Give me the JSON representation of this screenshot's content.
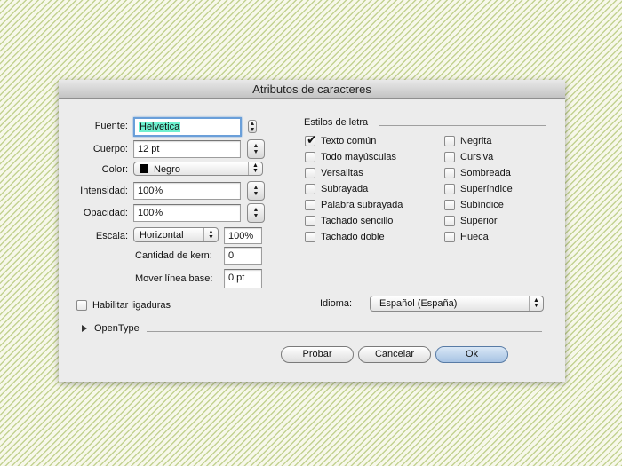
{
  "window": {
    "title": "Atributos de caracteres"
  },
  "left": {
    "font_label": "Fuente:",
    "font_value": "Helvetica",
    "size_label": "Cuerpo:",
    "size_value": "12 pt",
    "color_label": "Color:",
    "color_value": "Negro",
    "color_swatch": "#000000",
    "intensity_label": "Intensidad:",
    "intensity_value": "100%",
    "opacity_label": "Opacidad:",
    "opacity_value": "100%",
    "scale_label": "Escala:",
    "scale_mode": "Horizontal",
    "scale_value": "100%",
    "kern_label": "Cantidad de kern:",
    "kern_value": "0",
    "baseline_label": "Mover línea base:",
    "baseline_value": "0 pt",
    "ligatures_label": "Habilitar ligaduras",
    "ligatures_checked": false
  },
  "styles": {
    "group_label": "Estilos de letra",
    "col1": [
      {
        "label": "Texto común",
        "checked": true
      },
      {
        "label": "Todo mayúsculas",
        "checked": false
      },
      {
        "label": "Versalitas",
        "checked": false
      },
      {
        "label": "Subrayada",
        "checked": false
      },
      {
        "label": "Palabra subrayada",
        "checked": false
      },
      {
        "label": "Tachado sencillo",
        "checked": false
      },
      {
        "label": "Tachado doble",
        "checked": false
      }
    ],
    "col2": [
      {
        "label": "Negrita",
        "checked": false
      },
      {
        "label": "Cursiva",
        "checked": false
      },
      {
        "label": "Sombreada",
        "checked": false
      },
      {
        "label": "Superíndice",
        "checked": false
      },
      {
        "label": "Subíndice",
        "checked": false
      },
      {
        "label": "Superior",
        "checked": false
      },
      {
        "label": "Hueca",
        "checked": false
      }
    ]
  },
  "language": {
    "label": "Idioma:",
    "value": "Español (España)"
  },
  "opentype": {
    "label": "OpenType"
  },
  "buttons": {
    "preview": "Probar",
    "cancel": "Cancelar",
    "ok": "Ok"
  },
  "icons": {
    "check": "checkmark-icon",
    "stepper": "stepper-arrows-icon",
    "popup": "popup-arrows-icon",
    "disclosure": "disclosure-triangle-icon"
  }
}
